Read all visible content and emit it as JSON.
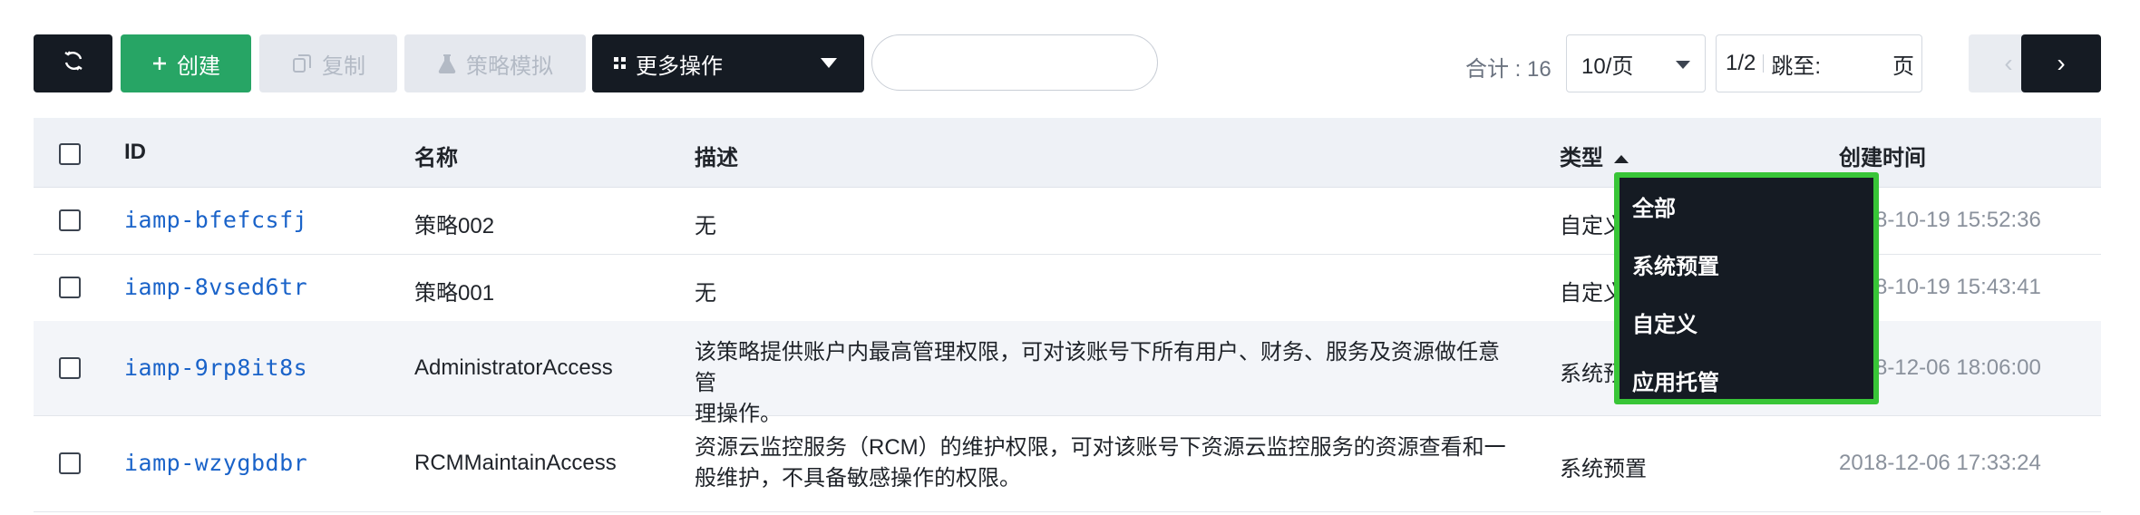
{
  "toolbar": {
    "create_label": "创建",
    "copy_label": "复制",
    "simulate_label": "策略模拟",
    "more_label": "更多操作",
    "search_value": "",
    "total_text": "合计 : 16",
    "page_size": "10/页",
    "page_current": "1/2",
    "jump_label": "跳至:",
    "jump_unit": "页"
  },
  "columns": {
    "id": "ID",
    "name": "名称",
    "desc": "描述",
    "type": "类型",
    "created": "创建时间"
  },
  "rows": [
    {
      "id": "iamp-bfefcsfj",
      "name": "策略002",
      "desc": "无",
      "type": "自定义",
      "created": "2018-10-19 15:52:36"
    },
    {
      "id": "iamp-8vsed6tr",
      "name": "策略001",
      "desc": "无",
      "type": "自定义",
      "created": "2018-10-19 15:43:41"
    },
    {
      "id": "iamp-9rp8it8s",
      "name": "AdministratorAccess",
      "desc_line1": "该策略提供账户内最高管理权限，可对该账号下所有用户、财务、服务及资源做任意管",
      "desc_line2": "理操作。",
      "type": "系统预置",
      "created": "2018-12-06 18:06:00"
    },
    {
      "id": "iamp-wzygbdbr",
      "name": "RCMMaintainAccess",
      "desc_line1": "资源云监控服务（RCM）的维护权限，可对该账号下资源云监控服务的资源查看和一",
      "desc_line2": "般维护，不具备敏感操作的权限。",
      "type": "系统预置",
      "created": "2018-12-06 17:33:24"
    }
  ],
  "type_filter": {
    "options": [
      "全部",
      "系统预置",
      "自定义",
      "应用托管"
    ]
  },
  "colors": {
    "accent_green": "#27a565",
    "dark": "#151b23",
    "link": "#1a63c9",
    "highlight": "#38c537"
  },
  "icons": [
    "refresh-icon",
    "plus-icon",
    "copy-icon",
    "flask-icon",
    "grid-icon",
    "chevron-down-icon",
    "chevron-left-icon",
    "chevron-right-icon",
    "sort-asc-icon"
  ]
}
